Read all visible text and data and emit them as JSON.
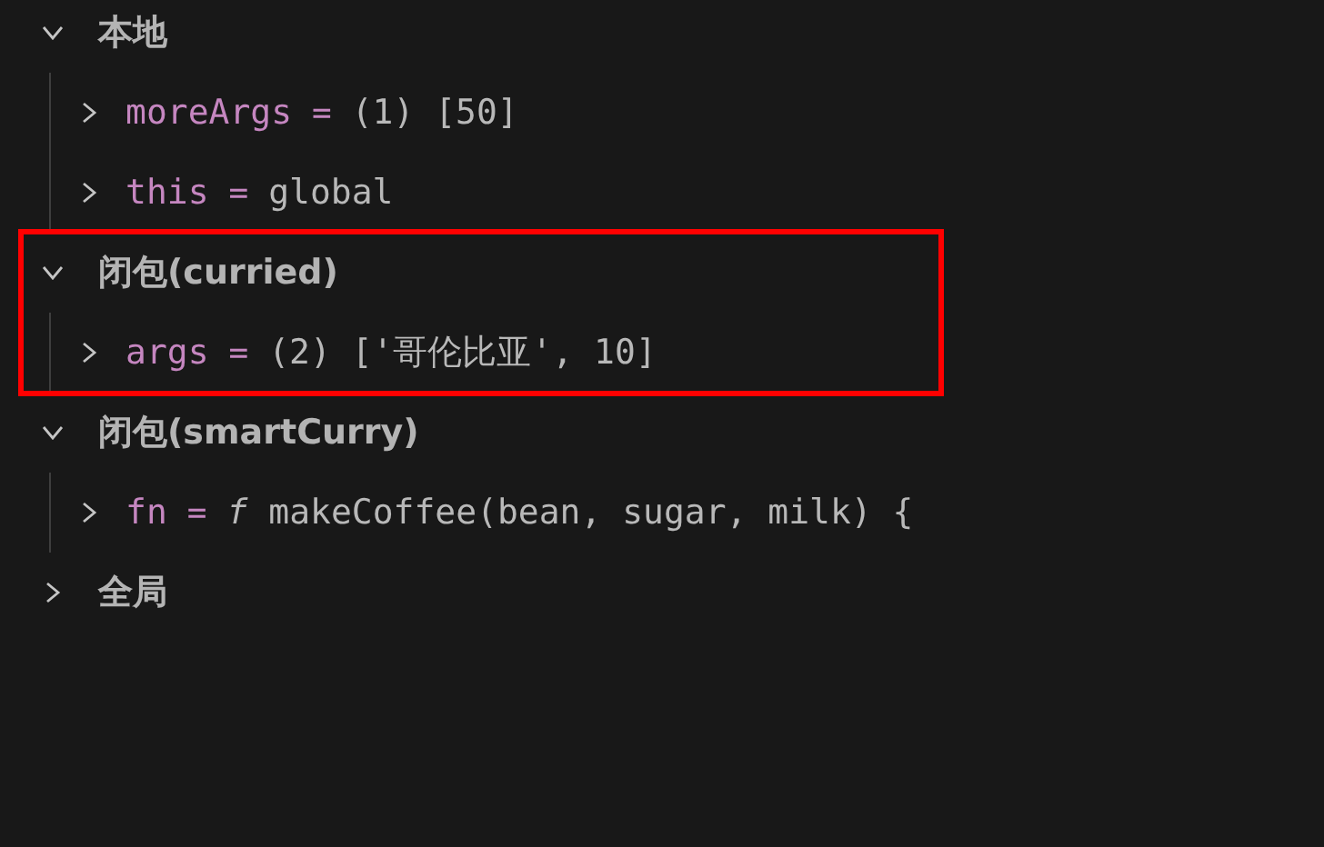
{
  "scopes": [
    {
      "label": "本地",
      "expanded": true,
      "highlighted": false,
      "variables": [
        {
          "name": "moreArgs",
          "separator": "=",
          "value": "(1) [50]",
          "expanded": false
        },
        {
          "name": "this",
          "separator": "=",
          "value": "global",
          "expanded": false
        }
      ]
    },
    {
      "label": "闭包(curried)",
      "expanded": true,
      "highlighted": true,
      "variables": [
        {
          "name": "args",
          "separator": "=",
          "value": "(2) ['哥伦比亚', 10]",
          "expanded": false
        }
      ]
    },
    {
      "label": "闭包(smartCurry)",
      "expanded": true,
      "highlighted": false,
      "variables": [
        {
          "name": "fn",
          "separator": "=",
          "value": "*f* makeCoffee(bean, sugar, milk) {",
          "expanded": false
        }
      ]
    },
    {
      "label": "全局",
      "expanded": false,
      "highlighted": false
    }
  ]
}
